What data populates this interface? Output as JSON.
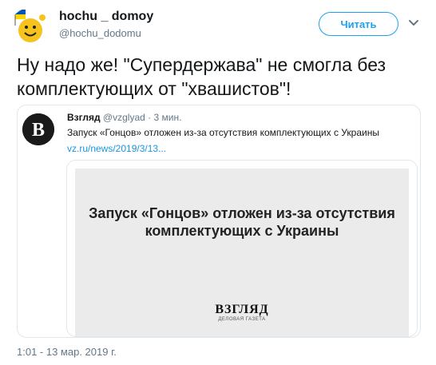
{
  "author": {
    "name": "hochu _ domoy",
    "handle": "@hochu_dodomu",
    "avatar": "smiling-sun-emoji-with-flag-avatar"
  },
  "follow_button": {
    "label": "Читать"
  },
  "tweet": {
    "text": "Ну надо же! \"Супердержава\" не смогла без комплектующих от \"хвашистов\"!",
    "timestamp": "1:01 - 13 мар. 2019 г."
  },
  "quoted": {
    "name": "Взгляд",
    "handle": "@vzglyad",
    "separator": "·",
    "time": "3 мин.",
    "text": "Запуск «Гонцов» отложен из-за отсутствия комплектующих с Украины",
    "link": "vz.ru/news/2019/3/13...",
    "card": {
      "headline": "Запуск «Гонцов» отложен из-за отсутствия комплектующих с Украины",
      "logo_text": "ВЗГЛЯД",
      "logo_sub": "ДЕЛОВАЯ ГАЗЕТА"
    }
  },
  "colors": {
    "accent": "#1da1f2",
    "link": "#1b95e0",
    "muted": "#657786",
    "border": "#e1e8ed"
  }
}
